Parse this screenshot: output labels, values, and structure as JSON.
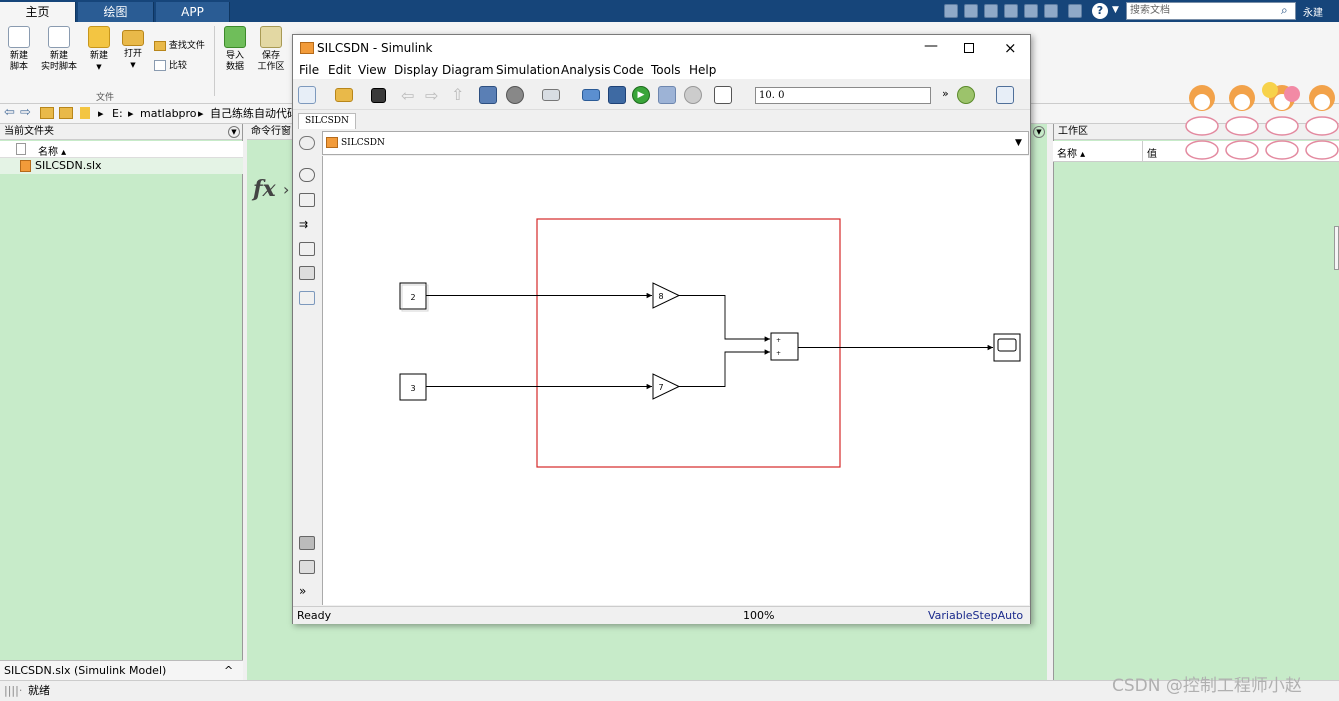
{
  "ribbon": {
    "tabs": [
      "主页",
      "绘图",
      "APP"
    ],
    "search_placeholder": "搜索文档",
    "user": "永建",
    "buttons": {
      "new_script": "新建\n脚本",
      "new_live_script": "新建\n实时脚本",
      "new": "新建",
      "open": "打开",
      "find_files": "查找文件",
      "compare": "比较",
      "import_data": "导入\n数据",
      "save_workspace": "保存\n工作区"
    },
    "group_file": "文件"
  },
  "address": {
    "drive": "E:",
    "folder1": "matlabpro",
    "folder2": "自己练练自动代码"
  },
  "left_panel": {
    "title": "当前文件夹",
    "column_name": "名称 ▴",
    "file": "SILCSDN.slx",
    "footer": "SILCSDN.slx  (Simulink Model)",
    "footer_chevron": "^"
  },
  "command_window": {
    "title": "命令行窗"
  },
  "workspace": {
    "title": "工作区",
    "col_name": "名称 ▴",
    "col_value": "值"
  },
  "status": {
    "text": "就绪"
  },
  "simulink": {
    "title": "SILCSDN - Simulink",
    "menu": [
      "File",
      "Edit",
      "View",
      "Display",
      "Diagram",
      "Simulation",
      "Analysis",
      "Code",
      "Tools",
      "Help"
    ],
    "stop_time": "10. 0",
    "tab": "SILCSDN",
    "breadcrumb": "SILCSDN",
    "status_ready": "Ready",
    "status_zoom": "100%",
    "status_solver": "VariableStepAuto",
    "blocks": {
      "const1": "2",
      "const2": "3",
      "gain1": "8",
      "gain2": "7",
      "sum_sign1": "+",
      "sum_sign2": "+"
    }
  },
  "watermark": "CSDN @控制工程师小赵",
  "colors": {
    "ribbon_blue": "#16457a",
    "panel_green": "#c7ebc9",
    "highlight_red": "#d42828",
    "solver_blue": "#1a2a8c"
  }
}
